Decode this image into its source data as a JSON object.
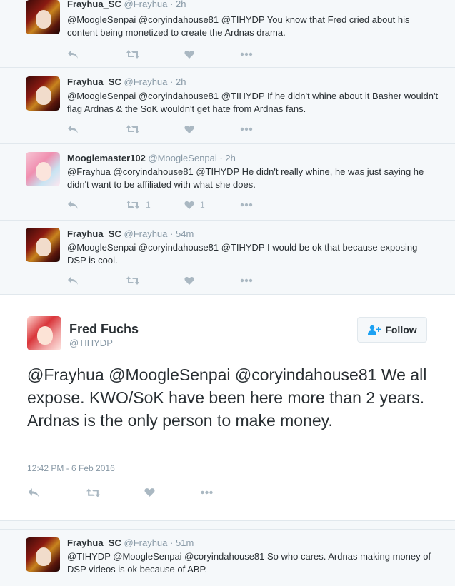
{
  "replies_above": [
    {
      "name": "Frayhua_SC",
      "handle": "@Frayhua",
      "time": "2h",
      "text": "@MoogleSenpai @coryindahouse81 @TIHYDP You know that Fred cried about his content being monetized to create the Ardnas drama.",
      "retweets": "",
      "likes": ""
    },
    {
      "name": "Frayhua_SC",
      "handle": "@Frayhua",
      "time": "2h",
      "text": "@MoogleSenpai @coryindahouse81 @TIHYDP If he didn't whine about it Basher wouldn't flag Ardnas & the SoK wouldn't get hate from Ardnas fans.",
      "retweets": "",
      "likes": ""
    },
    {
      "name": "Mooglemaster102",
      "handle": "@MoogleSenpai",
      "time": "2h",
      "text": "@Frayhua @coryindahouse81 @TIHYDP He didn't really whine, he was just saying he didn't want to be affiliated with what she does.",
      "retweets": "1",
      "likes": "1"
    },
    {
      "name": "Frayhua_SC",
      "handle": "@Frayhua",
      "time": "54m",
      "text": "@MoogleSenpai @coryindahouse81 @TIHYDP I would be ok that because exposing DSP is cool.",
      "retweets": "",
      "likes": ""
    }
  ],
  "focus_tweet": {
    "name": "Fred Fuchs",
    "handle": "@TIHYDP",
    "follow_label": "Follow",
    "text": "@Frayhua @MoogleSenpai @coryindahouse81 We all expose. KWO/SoK have been here more than 2 years. Ardnas is the only person to make money.",
    "date": "12:42 PM - 6 Feb 2016"
  },
  "replies_below": [
    {
      "name": "Frayhua_SC",
      "handle": "@Frayhua",
      "time": "51m",
      "text": "@TIHYDP @MoogleSenpai @coryindahouse81 So who cares.  Ardnas making money of DSP videos is ok because of ABP."
    }
  ],
  "separator": "·",
  "icons": {
    "reply": "reply-icon",
    "retweet": "retweet-icon",
    "like": "heart-icon",
    "more": "more-icon",
    "follow": "follow-person-icon"
  },
  "colors": {
    "icon_gray": "#aab8c2",
    "follow_blue": "#1da1f2",
    "secondary_text": "#8899a6",
    "primary_text": "#292f33"
  }
}
